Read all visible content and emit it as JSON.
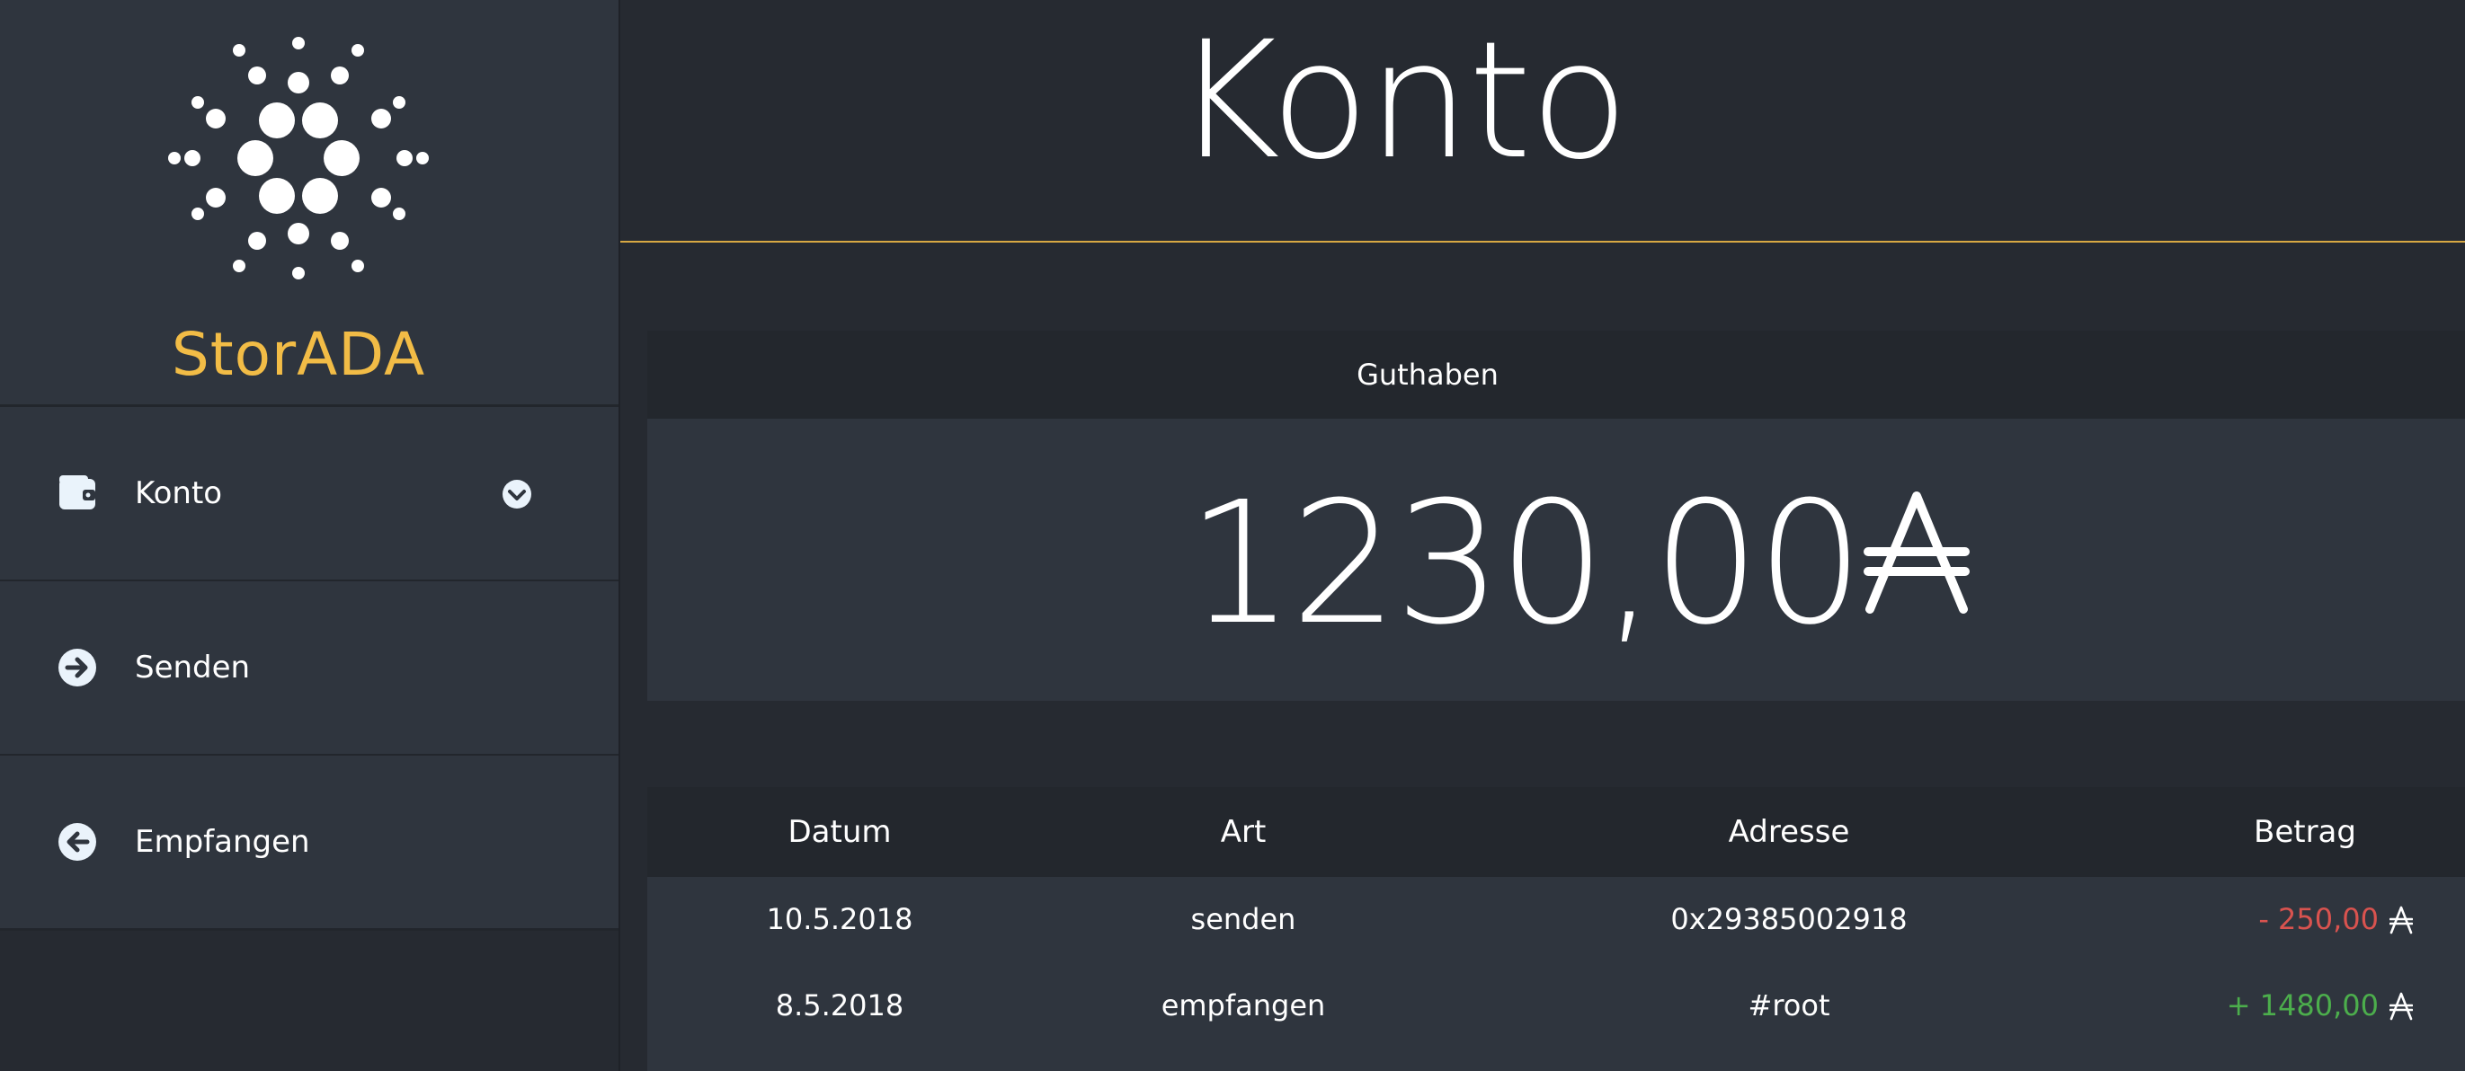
{
  "brand": {
    "name": "StorADA",
    "logo_icon": "cardano-logo-icon",
    "accent_color": "#f2bc46"
  },
  "sidebar": {
    "items": [
      {
        "label": "Konto",
        "icon": "wallet-icon",
        "expandable": true,
        "caret_icon": "chevron-down-circle-icon"
      },
      {
        "label": "Senden",
        "icon": "arrow-right-circle-icon"
      },
      {
        "label": "Empfangen",
        "icon": "arrow-left-circle-icon"
      }
    ]
  },
  "header": {
    "title": "Konto"
  },
  "balance": {
    "label": "Guthaben",
    "value": "1230,00",
    "currency_icon": "ada-currency-icon"
  },
  "transactions": {
    "columns": [
      "Datum",
      "Art",
      "Adresse",
      "Betrag"
    ],
    "rows": [
      {
        "date": "10.5.2018",
        "type": "senden",
        "address": "0x29385002918",
        "amount": "- 250,00",
        "direction": "negative"
      },
      {
        "date": "8.5.2018",
        "type": "empfangen",
        "address": "#root",
        "amount": "+ 1480,00",
        "direction": "positive"
      }
    ]
  },
  "colors": {
    "negative": "#d9534f",
    "positive": "#4cae4c",
    "divider": "#d7a843"
  }
}
